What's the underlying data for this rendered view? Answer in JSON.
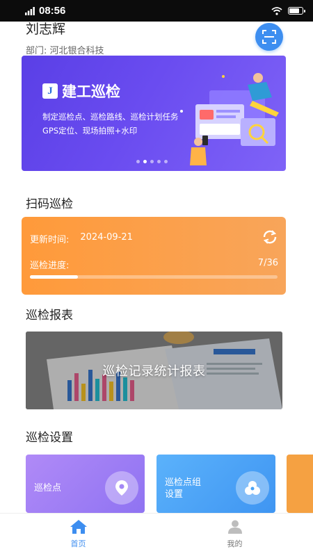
{
  "status_bar": {
    "signal": "4G",
    "time": "08:56"
  },
  "header": {
    "username": "刘志辉",
    "department": "部门: 河北银合科技"
  },
  "banner": {
    "brand_logo": "J",
    "brand_name": "建工巡检",
    "line1": "制定巡检点、巡检路线、巡检计划任务",
    "line2": "GPS定位、现场拍照+水印",
    "dot_count": 5,
    "active_dot": 1
  },
  "scan_section": {
    "title": "扫码巡检",
    "update_label": "更新时间:",
    "update_date": "2024-09-21",
    "progress_label": "巡检进度:",
    "progress_text": "7/36",
    "progress_done": 7,
    "progress_total": 36
  },
  "report_section": {
    "title": "巡检报表",
    "card_label": "巡检记录统计报表"
  },
  "settings_section": {
    "title": "巡检设置",
    "cards": [
      {
        "label": "巡检点",
        "icon": "location-pin-icon"
      },
      {
        "label_line1": "巡检点组",
        "label_line2": "设置",
        "icon": "group-icon"
      }
    ]
  },
  "tabs": [
    {
      "label": "首页",
      "icon": "home-icon",
      "active": true
    },
    {
      "label": "我的",
      "icon": "user-icon",
      "active": false
    }
  ],
  "colors": {
    "accent": "#3d8ef0",
    "banner": "#5a3fe6",
    "scan_card": "#ff9a3a",
    "card_purple": "#9b7cf5",
    "card_blue": "#4aa3f5",
    "tab_active": "#3d8ef0",
    "tab_inactive": "#777777"
  }
}
